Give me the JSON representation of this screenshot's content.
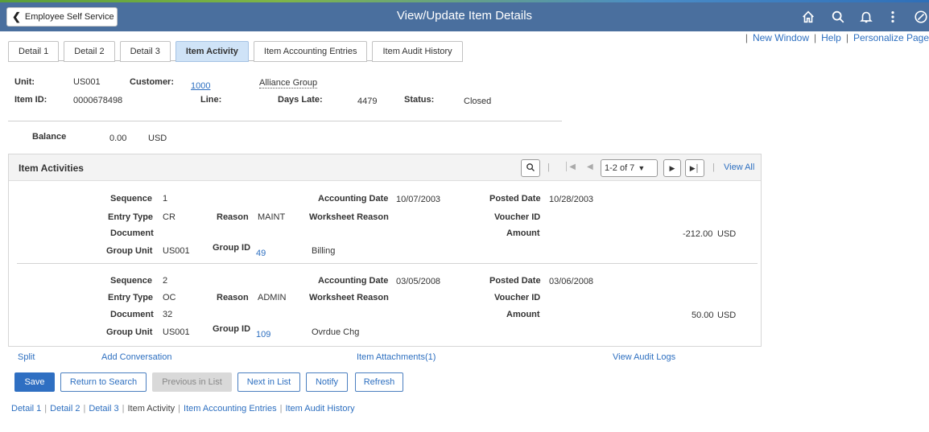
{
  "header": {
    "back_label": "Employee Self Service",
    "title": "View/Update Item Details",
    "icons": [
      "home-icon",
      "search-icon",
      "notification-icon",
      "actions-menu-icon",
      "navbar-icon"
    ]
  },
  "top_links": {
    "new_window": "New Window",
    "help": "Help",
    "personalize": "Personalize Page"
  },
  "tabs": [
    {
      "label": "Detail 1",
      "active": false
    },
    {
      "label": "Detail 2",
      "active": false
    },
    {
      "label": "Detail 3",
      "active": false
    },
    {
      "label": "Item Activity",
      "active": true
    },
    {
      "label": "Item Accounting Entries",
      "active": false
    },
    {
      "label": "Item Audit History",
      "active": false
    }
  ],
  "item": {
    "unit_label": "Unit:",
    "unit": "US001",
    "customer_label": "Customer:",
    "customer_id": "1000",
    "customer_name": "Alliance Group",
    "item_id_label": "Item ID:",
    "item_id": "0000678498",
    "line_label": "Line:",
    "days_late_label": "Days Late:",
    "days_late": "4479",
    "status_label": "Status:",
    "status": "Closed",
    "balance_label": "Balance",
    "balance": "0.00",
    "currency": "USD"
  },
  "grid": {
    "title": "Item Activities",
    "pagination": "1-2 of 7",
    "view_all": "View All",
    "labels": {
      "sequence": "Sequence",
      "entry_type": "Entry Type",
      "document": "Document",
      "group_unit": "Group Unit",
      "reason": "Reason",
      "group_id": "Group ID",
      "accounting_date": "Accounting Date",
      "worksheet_reason": "Worksheet Reason",
      "posted_date": "Posted Date",
      "voucher_id": "Voucher ID",
      "amount": "Amount"
    },
    "rows": [
      {
        "sequence": "1",
        "entry_type": "CR",
        "document": "",
        "group_unit": "US001",
        "reason": "MAINT",
        "group_id": "49",
        "group_type": "Billing",
        "accounting_date": "10/07/2003",
        "posted_date": "10/28/2003",
        "voucher_id": "",
        "amount": "-212.00",
        "currency": "USD"
      },
      {
        "sequence": "2",
        "entry_type": "OC",
        "document": "32",
        "group_unit": "US001",
        "reason": "ADMIN",
        "group_id": "109",
        "group_type": "Ovrdue Chg",
        "accounting_date": "03/05/2008",
        "posted_date": "03/06/2008",
        "voucher_id": "",
        "amount": "50.00",
        "currency": "USD"
      }
    ]
  },
  "bottom_links": {
    "split": "Split",
    "add_conversation": "Add Conversation",
    "attachments": "Item Attachments(1)",
    "audit_logs": "View Audit Logs"
  },
  "buttons": {
    "save": "Save",
    "return": "Return to Search",
    "previous": "Previous in List",
    "next": "Next in List",
    "notify": "Notify",
    "refresh": "Refresh"
  },
  "footer_nav": [
    "Detail 1",
    "Detail 2",
    "Detail 3",
    "Item Activity",
    "Item Accounting Entries",
    "Item Audit History"
  ]
}
